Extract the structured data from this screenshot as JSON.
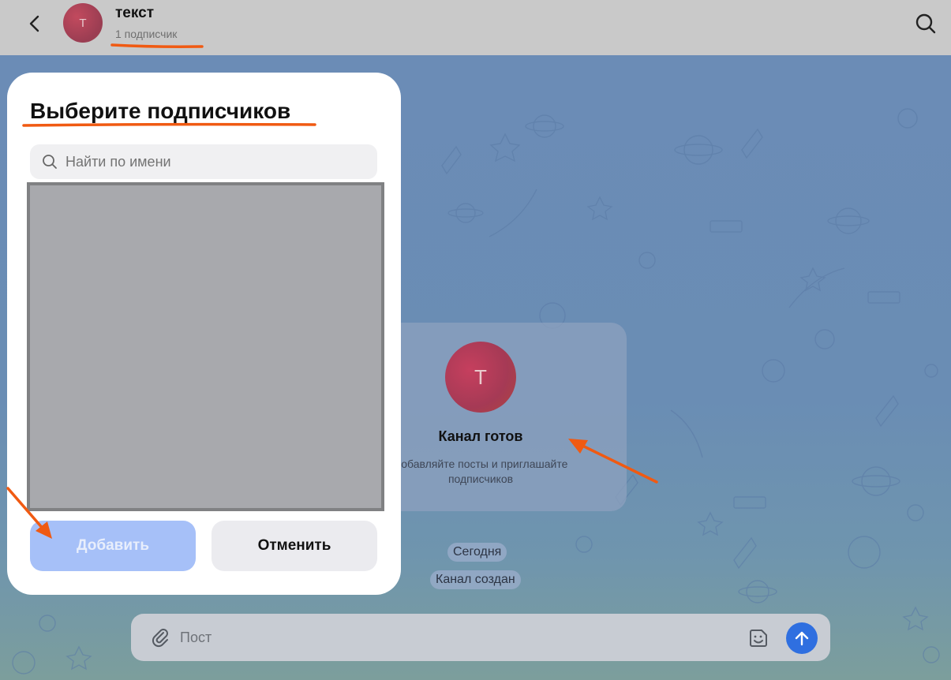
{
  "header": {
    "back_icon": "chevron-left-icon",
    "avatar_letter": "T",
    "channel_title": "текст",
    "subscriber_count": "1 подписчик",
    "search_icon": "search-icon"
  },
  "channel_card": {
    "avatar_letter": "T",
    "title": "Канал готов",
    "description": "Добавляйте посты и приглашайте подписчиков"
  },
  "service_messages": {
    "date": "Сегодня",
    "event": "Канал создан"
  },
  "composer": {
    "attach_icon": "paperclip-icon",
    "placeholder": "Пост",
    "sticker_icon": "sticker-icon",
    "send_icon": "arrow-up-icon"
  },
  "dialog": {
    "title": "Выберите подписчиков",
    "search_placeholder": "Найти по имени",
    "add_label": "Добавить",
    "cancel_label": "Отменить"
  },
  "colors": {
    "accent": "#2f6fe0",
    "annotation": "#f05a12",
    "add_button_disabled": "#a6c0f8",
    "chat_background": "#6b8cb6"
  }
}
